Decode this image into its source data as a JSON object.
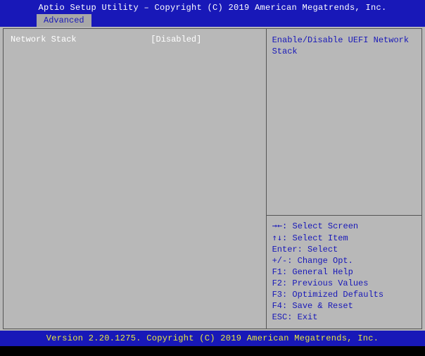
{
  "header": {
    "title": "Aptio Setup Utility – Copyright (C) 2019 American Megatrends, Inc."
  },
  "tabs": {
    "active": "Advanced"
  },
  "settings": [
    {
      "label": "Network Stack",
      "value": "[Disabled]"
    }
  ],
  "help": {
    "description": "Enable/Disable UEFI Network Stack"
  },
  "legend": [
    {
      "key": "→←:",
      "action": "Select Screen"
    },
    {
      "key": "↑↓:",
      "action": "Select Item"
    },
    {
      "key": "Enter:",
      "action": "Select"
    },
    {
      "key": "+/-:",
      "action": "Change Opt."
    },
    {
      "key": "F1:",
      "action": "General Help"
    },
    {
      "key": "F2:",
      "action": "Previous Values"
    },
    {
      "key": "F3:",
      "action": "Optimized Defaults"
    },
    {
      "key": "F4:",
      "action": "Save & Reset"
    },
    {
      "key": "ESC:",
      "action": "Exit"
    }
  ],
  "footer": {
    "version": "Version 2.20.1275. Copyright (C) 2019 American Megatrends, Inc."
  }
}
